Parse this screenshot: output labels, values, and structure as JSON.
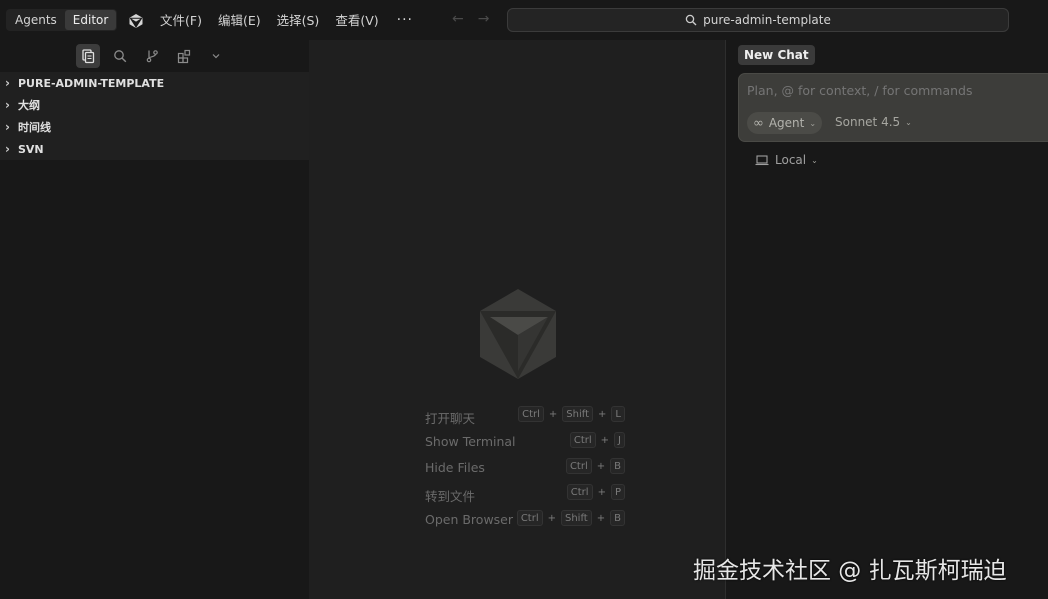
{
  "titlebar": {
    "modes": [
      {
        "label": "Agents",
        "active": false
      },
      {
        "label": "Editor",
        "active": true
      }
    ],
    "menu": [
      "文件(F)",
      "编辑(E)",
      "选择(S)",
      "查看(V)"
    ],
    "more": "···",
    "nav": {
      "back": "←",
      "forward": "→"
    },
    "search_text": "pure-admin-template"
  },
  "sidebar": {
    "activity_icons": [
      "explorer-icon",
      "search-icon",
      "source-control-icon",
      "extensions-icon",
      "chevron-down-icon"
    ],
    "tree": [
      {
        "label": "PURE-ADMIN-TEMPLATE"
      },
      {
        "label": "大纲"
      },
      {
        "label": "时间线"
      },
      {
        "label": "SVN"
      }
    ]
  },
  "editor": {
    "shortcuts": [
      {
        "label": "打开聊天",
        "keys": [
          "Ctrl",
          "Shift",
          "L"
        ]
      },
      {
        "label": "Show Terminal",
        "keys": [
          "Ctrl",
          "J"
        ]
      },
      {
        "label": "Hide Files",
        "keys": [
          "Ctrl",
          "B"
        ]
      },
      {
        "label": "转到文件",
        "keys": [
          "Ctrl",
          "P"
        ]
      },
      {
        "label": "Open Browser",
        "keys": [
          "Ctrl",
          "Shift",
          "B"
        ]
      }
    ]
  },
  "chat": {
    "tab_label": "New Chat",
    "placeholder": "Plan, @ for context, / for commands",
    "agent_label": "Agent",
    "model_label": "Sonnet 4.5",
    "location_label": "Local"
  },
  "watermark": "掘金技术社区 @ 扎瓦斯柯瑞迫",
  "colors": {
    "background": "#181818",
    "editor_bg": "#1f1f1f",
    "composer_bg": "#3d3d3a",
    "text": "#cccccc",
    "muted": "#6b6b6b"
  }
}
